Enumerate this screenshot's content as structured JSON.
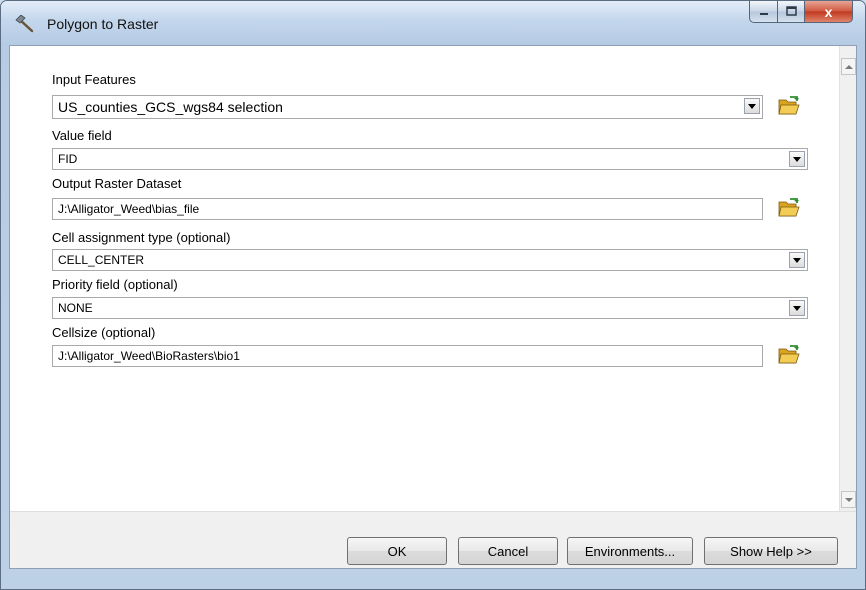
{
  "window": {
    "title": "Polygon to Raster"
  },
  "caption_buttons": {
    "close": "x"
  },
  "fields": [
    {
      "label": "Input Features",
      "value": "US_counties_GCS_wgs84 selection",
      "kind": "combo"
    },
    {
      "label": "Value field",
      "value": "FID",
      "kind": "combo"
    },
    {
      "label": "Output Raster Dataset",
      "value": "J:\\Alligator_Weed\\bias_file",
      "kind": "text"
    },
    {
      "label": "Cell assignment type (optional)",
      "value": "CELL_CENTER",
      "kind": "combo"
    },
    {
      "label": "Priority field (optional)",
      "value": "NONE",
      "kind": "combo"
    },
    {
      "label": "Cellsize (optional)",
      "value": "J:\\Alligator_Weed\\BioRasters\\bio1",
      "kind": "text"
    }
  ],
  "buttons": {
    "ok": "OK",
    "cancel": "Cancel",
    "environments": "Environments...",
    "show_help": "Show Help >>"
  },
  "icons": {
    "app": "hammer-icon",
    "browse": "folder-open-icon"
  },
  "colors": {
    "close_button": "#c73b20",
    "folder": "#e8b935",
    "folder_arrow": "#2f8e2f"
  }
}
